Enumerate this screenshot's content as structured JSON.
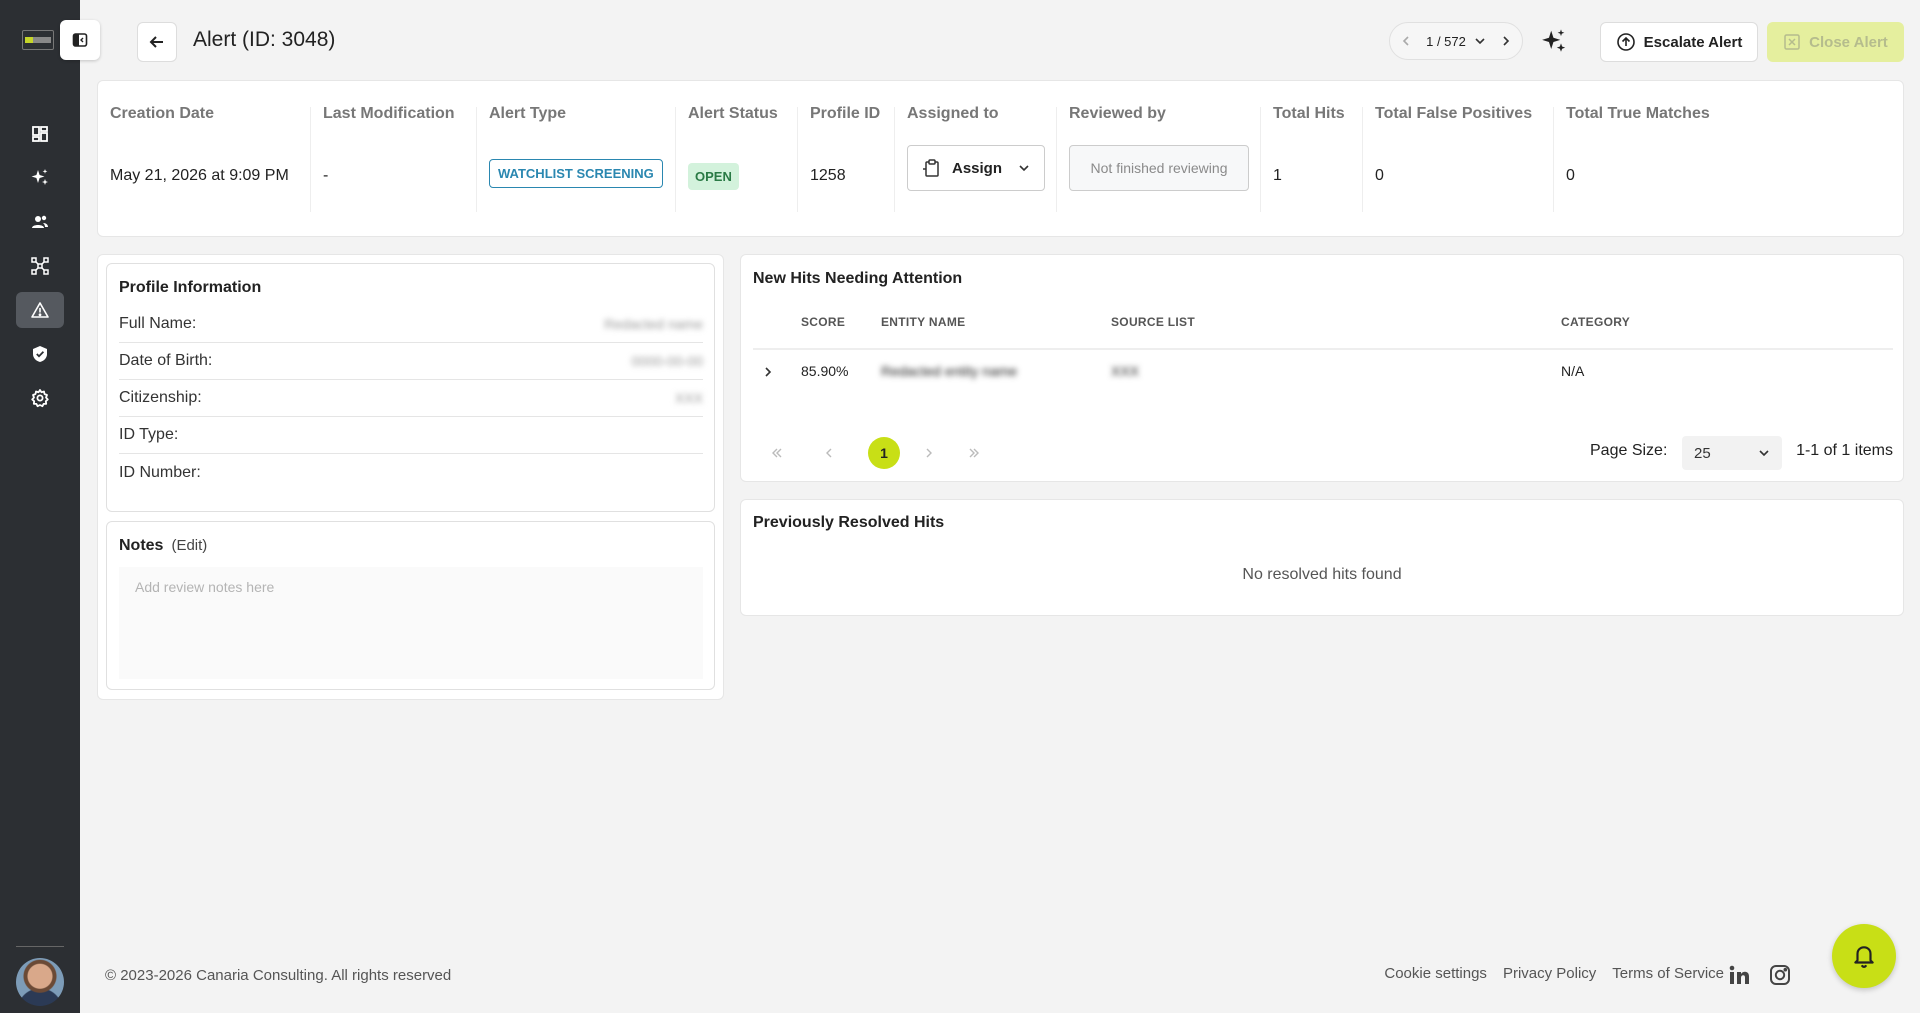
{
  "header": {
    "title": "Alert (ID: 3048)",
    "pager": "1 / 572",
    "escalate_label": "Escalate Alert",
    "close_label": "Close Alert"
  },
  "summary": {
    "columns": [
      {
        "header": "Creation Date",
        "value": "May 21, 2026 at 9:09 PM"
      },
      {
        "header": "Last Modification",
        "value": "-"
      },
      {
        "header": "Alert Type",
        "value": "WATCHLIST SCREENING"
      },
      {
        "header": "Alert Status",
        "value": "OPEN"
      },
      {
        "header": "Profile ID",
        "value": "1258"
      },
      {
        "header": "Assigned to",
        "value": "Assign"
      },
      {
        "header": "Reviewed by",
        "value": "Not finished reviewing"
      },
      {
        "header": "Total Hits",
        "value": "1"
      },
      {
        "header": "Total False Positives",
        "value": "0"
      },
      {
        "header": "Total True Matches",
        "value": "0"
      }
    ]
  },
  "profile": {
    "title": "Profile Information",
    "rows": [
      {
        "label": "Full Name:",
        "value": "Redacted name"
      },
      {
        "label": "Date of Birth:",
        "value": "0000-00-00"
      },
      {
        "label": "Citizenship:",
        "value": "XXX"
      },
      {
        "label": "ID Type:",
        "value": ""
      },
      {
        "label": "ID Number:",
        "value": ""
      }
    ]
  },
  "notes": {
    "title": "Notes",
    "edit_label": "(Edit)",
    "placeholder": "Add review notes here"
  },
  "hits": {
    "title": "New Hits Needing Attention",
    "columns": [
      "SCORE",
      "ENTITY NAME",
      "SOURCE LIST",
      "CATEGORY"
    ],
    "rows": [
      {
        "score": "85.90%",
        "entity_name": "Redacted entity name",
        "source_list": "XXX",
        "category": "N/A"
      }
    ],
    "current_page": "1",
    "page_size_label": "Page Size:",
    "page_size": "25",
    "items_count": "1-1 of 1 items"
  },
  "resolved": {
    "title": "Previously Resolved Hits",
    "empty_message": "No resolved hits found"
  },
  "footer": {
    "copyright": "© 2023-2026 Canaria Consulting. All rights reserved",
    "links": [
      "Cookie settings",
      "Privacy Policy",
      "Terms of Service"
    ]
  },
  "colors": {
    "sidebar": "#2c2f33",
    "accent": "#c8df16",
    "link": "#2a87b0",
    "open_badge": "#d3f2dc"
  }
}
